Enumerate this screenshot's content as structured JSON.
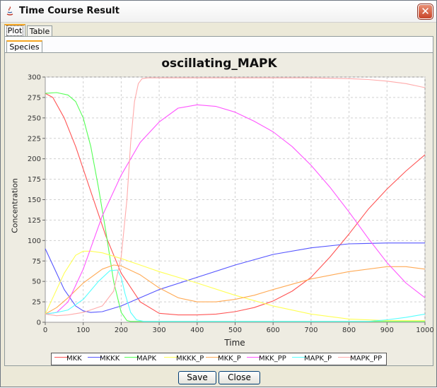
{
  "window": {
    "title": "Time Course Result"
  },
  "tabs": [
    {
      "label": "Plot",
      "selected": true
    },
    {
      "label": "Table",
      "selected": false
    }
  ],
  "subtabs": [
    {
      "label": "Species",
      "selected": true
    }
  ],
  "buttons": {
    "save_label": "Save",
    "close_label": "Close"
  },
  "chart_data": {
    "type": "line",
    "title": "oscillating_MAPK",
    "xlabel": "Time",
    "ylabel": "Concentration",
    "xlim": [
      0,
      1000
    ],
    "ylim": [
      0,
      300
    ],
    "x_ticks": [
      0,
      100,
      200,
      300,
      400,
      500,
      600,
      700,
      800,
      900,
      1000
    ],
    "y_ticks": [
      0,
      25,
      50,
      75,
      100,
      125,
      150,
      175,
      200,
      225,
      250,
      275,
      300
    ],
    "grid": true,
    "legend_position": "bottom",
    "series": [
      {
        "name": "MKK",
        "color": "#ff5555",
        "x": [
          0,
          20,
          50,
          80,
          120,
          160,
          200,
          250,
          300,
          350,
          400,
          450,
          500,
          550,
          600,
          650,
          700,
          750,
          800,
          850,
          900,
          950,
          1000
        ],
        "y": [
          280,
          275,
          250,
          215,
          160,
          105,
          60,
          25,
          11,
          9,
          9,
          10,
          13,
          18,
          26,
          38,
          55,
          80,
          108,
          138,
          163,
          185,
          205
        ]
      },
      {
        "name": "MKKK",
        "color": "#5555ff",
        "x": [
          0,
          20,
          50,
          80,
          100,
          120,
          150,
          200,
          250,
          300,
          400,
          500,
          600,
          700,
          800,
          900,
          1000
        ],
        "y": [
          90,
          70,
          40,
          20,
          14,
          12,
          13,
          20,
          30,
          40,
          55,
          70,
          83,
          91,
          96,
          97,
          97
        ]
      },
      {
        "name": "MAPK",
        "color": "#55ff55",
        "x": [
          0,
          30,
          60,
          80,
          100,
          120,
          140,
          160,
          180,
          200,
          215,
          225,
          240,
          300,
          500,
          700,
          1000
        ],
        "y": [
          280,
          281,
          278,
          270,
          250,
          215,
          165,
          110,
          50,
          12,
          2,
          1,
          1,
          1,
          1,
          1,
          1
        ]
      },
      {
        "name": "MKKK_P",
        "color": "#ffff55",
        "x": [
          0,
          20,
          50,
          80,
          100,
          120,
          150,
          200,
          250,
          300,
          400,
          500,
          600,
          700,
          800,
          900,
          1000
        ],
        "y": [
          10,
          30,
          60,
          82,
          87,
          87,
          85,
          78,
          70,
          62,
          48,
          33,
          20,
          10,
          4,
          2,
          2
        ]
      },
      {
        "name": "MKK_P",
        "color": "#ffaa55",
        "x": [
          0,
          30,
          60,
          100,
          150,
          180,
          200,
          250,
          300,
          350,
          400,
          450,
          500,
          550,
          600,
          700,
          800,
          900,
          950,
          1000
        ],
        "y": [
          10,
          18,
          30,
          48,
          65,
          70,
          69,
          58,
          42,
          30,
          25,
          25,
          28,
          33,
          40,
          53,
          62,
          68,
          68,
          65
        ]
      },
      {
        "name": "MKK_PP",
        "color": "#ff55ff",
        "x": [
          0,
          30,
          60,
          100,
          150,
          200,
          250,
          300,
          350,
          400,
          450,
          500,
          550,
          600,
          650,
          700,
          750,
          800,
          850,
          900,
          950,
          1000
        ],
        "y": [
          10,
          12,
          25,
          65,
          130,
          180,
          220,
          245,
          262,
          266,
          264,
          257,
          246,
          233,
          215,
          192,
          165,
          135,
          103,
          73,
          48,
          30
        ]
      },
      {
        "name": "MAPK_P",
        "color": "#55ffff",
        "x": [
          0,
          30,
          60,
          100,
          140,
          170,
          190,
          200,
          210,
          225,
          240,
          260,
          300,
          500,
          700,
          850,
          900,
          950,
          1000
        ],
        "y": [
          10,
          12,
          15,
          28,
          50,
          63,
          64,
          55,
          35,
          12,
          3,
          1,
          1,
          1,
          1,
          1,
          3,
          6,
          10
        ]
      },
      {
        "name": "MAPK_PP",
        "color": "#ffaaaa",
        "x": [
          0,
          30,
          60,
          100,
          150,
          180,
          200,
          215,
          225,
          235,
          245,
          255,
          270,
          300,
          500,
          700,
          800,
          850,
          900,
          950,
          1000
        ],
        "y": [
          10,
          8,
          9,
          12,
          20,
          38,
          80,
          150,
          220,
          270,
          292,
          298,
          299,
          299,
          299,
          299,
          298,
          297,
          295,
          292,
          287
        ]
      }
    ]
  }
}
